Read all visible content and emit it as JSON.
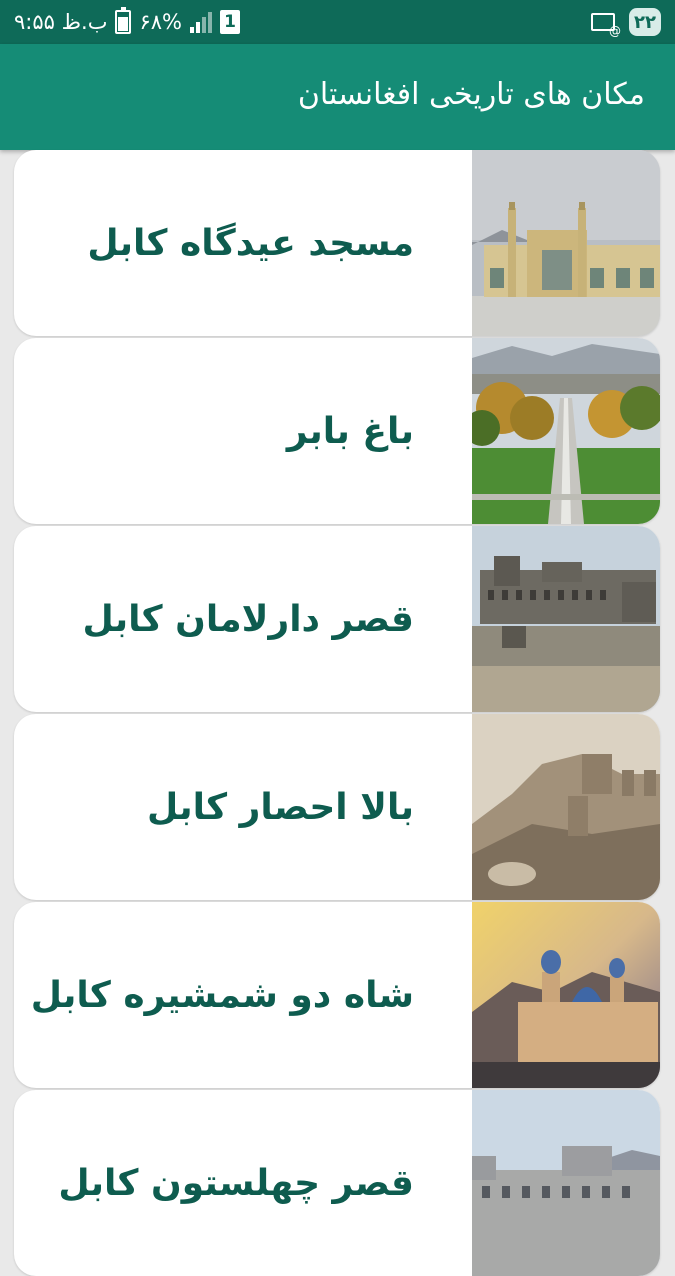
{
  "status_bar": {
    "time": "۹:۵۵ ب.ظ",
    "battery": "۶۸%",
    "battery_level": 0.68,
    "sim": "1",
    "notification_badge": "۲۲"
  },
  "app_bar": {
    "title": "مکان های تاریخی افغانستان"
  },
  "places": [
    {
      "label": "مسجد عیدگاه کابل",
      "image": "mosque-photo"
    },
    {
      "label": "باغ بابر",
      "image": "garden-photo"
    },
    {
      "label": "قصر دارلامان کابل",
      "image": "palace-ruins-photo"
    },
    {
      "label": "بالا احصار کابل",
      "image": "fortress-photo"
    },
    {
      "label": "شاه دو شمشیره کابل",
      "image": "blue-dome-mosque-photo"
    },
    {
      "label": "قصر چهلستون کابل",
      "image": "palace-photo"
    }
  ]
}
